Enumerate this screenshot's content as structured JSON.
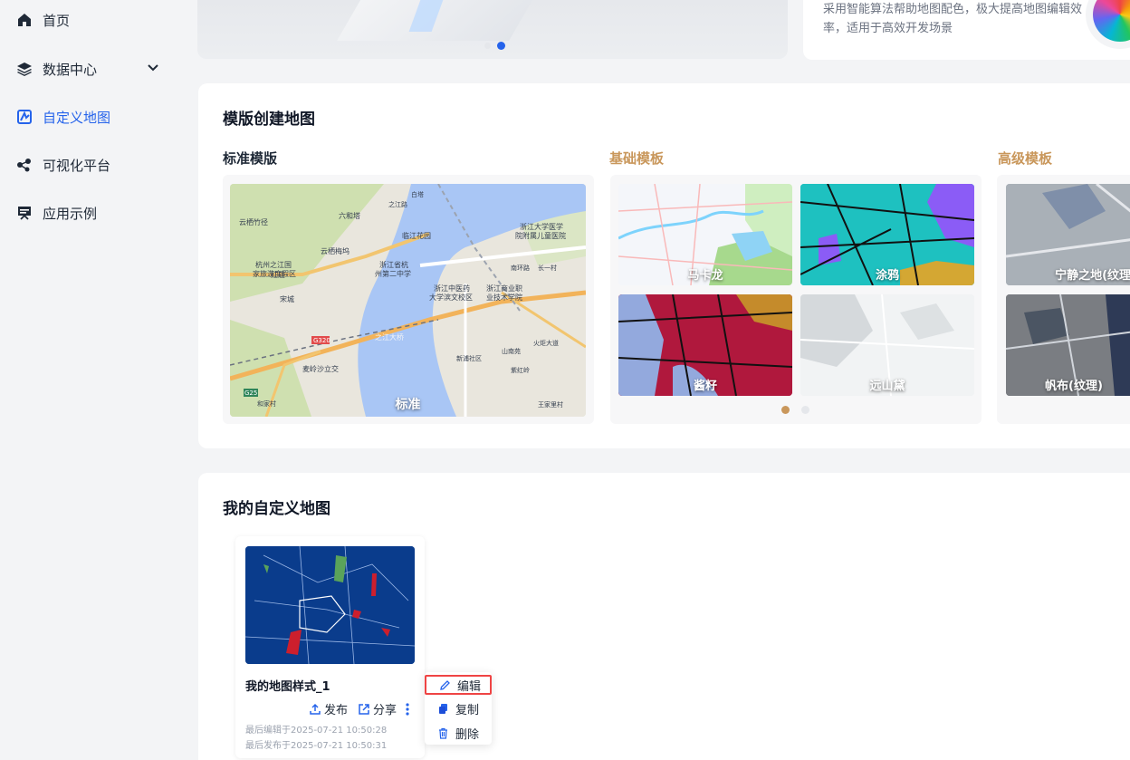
{
  "sidebar": {
    "items": [
      {
        "label": "首页",
        "icon": "home-icon"
      },
      {
        "label": "数据中心",
        "icon": "layers-icon"
      },
      {
        "label": "自定义地图",
        "icon": "custom-map-icon"
      },
      {
        "label": "可视化平台",
        "icon": "visualization-icon"
      },
      {
        "label": "应用示例",
        "icon": "presentation-icon"
      }
    ],
    "active_index": 2
  },
  "banner": {
    "description": "采用智能算法帮助地图配色，极大提高地图编辑效率，适用于高效开发场景"
  },
  "templates": {
    "title": "模版创建地图",
    "standard": {
      "title": "标准模版",
      "map_label": "标准",
      "places": [
        "云栖竹径",
        "六和塔",
        "之江路",
        "白塔",
        "浙江大学医学院附属儿童医院",
        "临江花园",
        "杭州之江国家旅游度假区",
        "浙江省杭州第二中学",
        "浙江中医药大学滨文校区",
        "浙江商业职业技术学院",
        "云栖梅坞",
        "红庙",
        "宋城",
        "麦岭沙立交",
        "之江大桥",
        "山南苑",
        "新浦社区",
        "紫红岭",
        "王家里村",
        "火炬大道",
        "长一村",
        "南环路",
        "和家村",
        "G320",
        "G25"
      ]
    },
    "basic": {
      "title": "基础模板",
      "items": [
        "马卡龙",
        "涂鸦",
        "酱籽",
        "远山黛"
      ]
    },
    "advanced": {
      "title": "高级模板",
      "items": [
        "宁静之地(纹理)",
        "帆布(纹理)"
      ]
    }
  },
  "my_maps": {
    "title": "我的自定义地图",
    "cards": [
      {
        "name": "我的地图样式_1",
        "publish_label": "发布",
        "share_label": "分享",
        "last_edited": "最后编辑于2025-07-21 10:50:28",
        "last_published": "最后发布于2025-07-21 10:50:31"
      }
    ],
    "menu": {
      "edit": "编辑",
      "copy": "复制",
      "delete": "删除"
    }
  },
  "colors": {
    "accent": "#2563eb",
    "gold": "#c9975b",
    "highlight": "#ef4444"
  }
}
